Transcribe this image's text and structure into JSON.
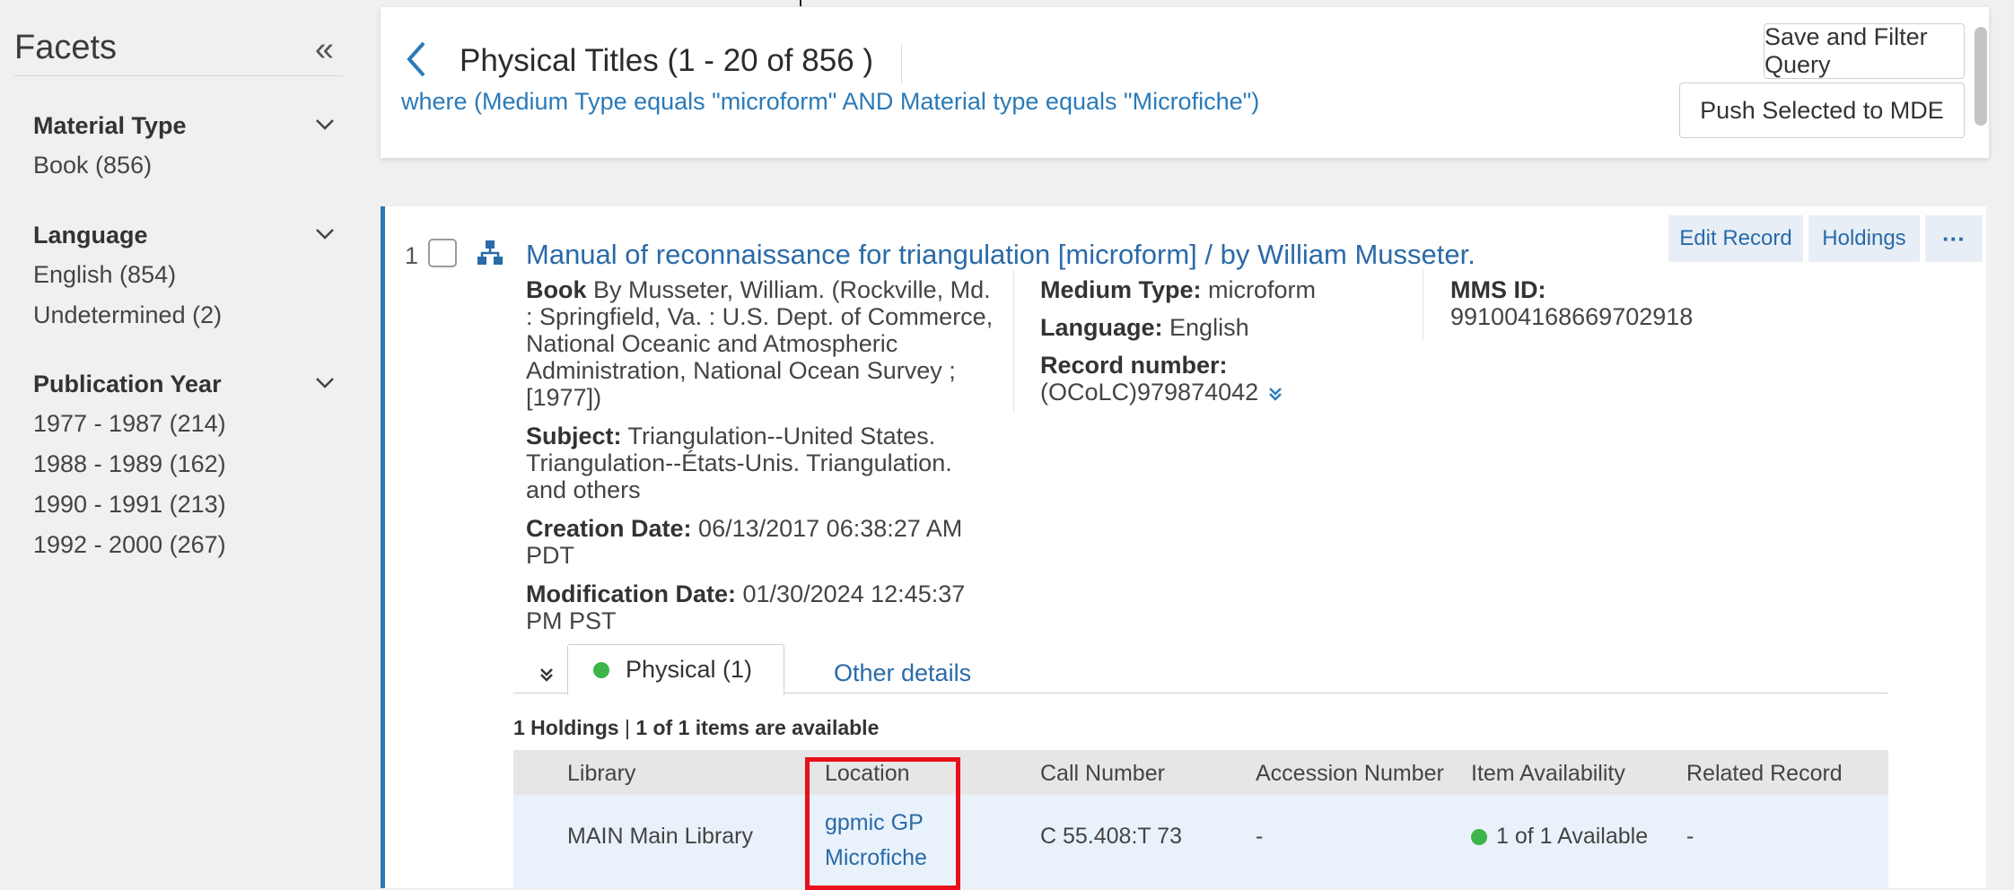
{
  "sidebar": {
    "title": "Facets",
    "collapse_icon": "«",
    "groups": [
      {
        "title": "Material Type",
        "values": [
          "Book (856)"
        ]
      },
      {
        "title": "Language",
        "values": [
          "English (854)",
          "Undetermined (2)"
        ]
      },
      {
        "title": "Publication Year",
        "values": [
          "1977 - 1987 (214)",
          "1988 - 1989 (162)",
          "1990 - 1991 (213)",
          "1992 - 2000 (267)"
        ]
      }
    ]
  },
  "header": {
    "title": "Physical Titles (1 - 20 of 856 )",
    "query": "where (Medium Type equals \"microform\" AND Material type equals \"Microfiche\")",
    "save_filter_label": "Save and Filter Query",
    "push_mde_label": "Push Selected to MDE"
  },
  "record": {
    "number": "1",
    "title": "Manual of reconnaissance for triangulation [microform] / by William Musseter.",
    "actions": {
      "edit": "Edit Record",
      "holdings": "Holdings",
      "more": "···"
    },
    "type_label": "Book",
    "description": "By Musseter, William. (Rockville, Md. : Springfield, Va. : U.S. Dept. of Commerce, National Oceanic and Atmospheric Administration, National Ocean Survey ; [1977])",
    "subject_label": "Subject:",
    "subject": "Triangulation--United States. Triangulation--États-Unis. Triangulation. and others",
    "creation_label": "Creation Date:",
    "creation": "06/13/2017 06:38:27 AM PDT",
    "modification_label": "Modification Date:",
    "modification": "01/30/2024 12:45:37 PM PST",
    "medium_label": "Medium Type:",
    "medium": "microform",
    "language_label": "Language:",
    "language": "English",
    "record_number_label": "Record number:",
    "record_number": "(OCoLC)979874042",
    "mms_label": "MMS ID:",
    "mms": "991004168669702918",
    "tabs": {
      "physical": "Physical (1)",
      "other": "Other details"
    },
    "holdings_count": "1 Holdings",
    "items_available": "1 of 1 items are available",
    "table": {
      "headers": [
        "Library",
        "Location",
        "Call Number",
        "Accession Number",
        "Item Availability",
        "Related Record"
      ],
      "row": {
        "library": "MAIN Main Library",
        "location_line1": "gpmic GP",
        "location_line2": "Microfiche",
        "call_number": "C 55.408:T 73",
        "accession": "-",
        "availability": "1 of 1 Available",
        "related": "-"
      }
    }
  },
  "colors": {
    "link": "#2a6aa8",
    "accent": "#2a7ab8",
    "available": "#3db54a",
    "highlight": "#e8101a"
  }
}
